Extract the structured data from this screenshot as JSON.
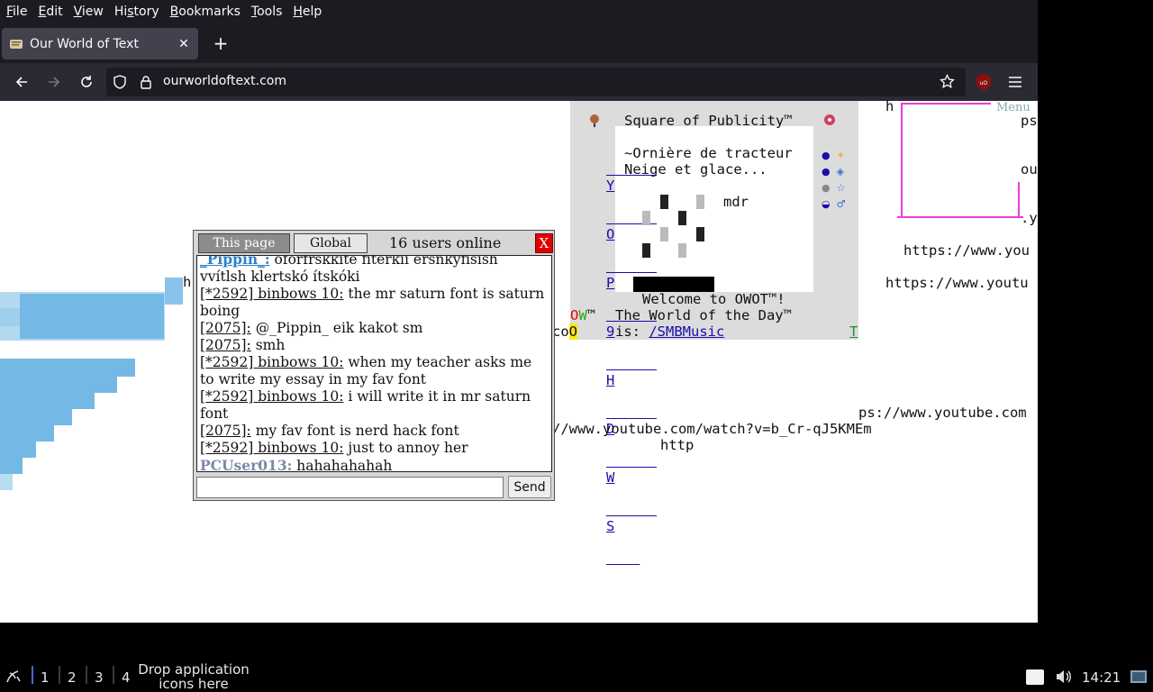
{
  "menubar": {
    "items": [
      "File",
      "Edit",
      "View",
      "History",
      "Bookmarks",
      "Tools",
      "Help"
    ],
    "underline": [
      "F",
      "E",
      "V",
      "s",
      "B",
      "T",
      "H"
    ]
  },
  "tab": {
    "title": "Our World of Text",
    "new_tab_symbol": "+"
  },
  "urlbar": {
    "url": "ourworldoftext.com"
  },
  "page": {
    "sop_title": "Square of Publicity™",
    "sop_line1": "~Ornière de tracteur",
    "sop_line2": "Neige et glace...",
    "sop_mdr": "mdr",
    "sop_welcome": "Welcome to OWOT™!",
    "sop_world_day": "The World of the Day™",
    "sop_is": "is: ",
    "sop_link": "/SMBMusic",
    "sop_left_col": [
      "Y",
      "O",
      "P",
      "9",
      "H",
      "D",
      "W",
      "S"
    ],
    "owot_o": "O",
    "owot_w": "W",
    "owot_tm": "™",
    "co_text": "co",
    "co_o": "O",
    "t_right": "T",
    "h_char": "h",
    "h_char2": "h",
    "menu_label": "Menu",
    "ps_text": "ps",
    "ou_text": "ou",
    "y_text": ".y",
    "yt_url1": "https://www.you",
    "yt_url2": "https://www.youtu",
    "yt_url3": "ps://www.youtube.com",
    "yt_url4": "//www.youtube.com/watch?v=b_Cr-qJ5KMEm",
    "http_text": "http"
  },
  "chat": {
    "tab_this_page": "This page",
    "tab_global": "Global",
    "users_online": "16 users online",
    "close_label": "X",
    "send_label": "Send",
    "input_value": "",
    "messages": [
      {
        "nick": "_Pippin_:",
        "text": " oforfrskkite fiterkii ersnkyfisish vvítlsh klertskó ítskóki",
        "style": "blue"
      },
      {
        "nick": "[*2592] binbows 10:",
        "text": " the mr saturn font is saturn boing",
        "style": "plain"
      },
      {
        "nick": "[2075]:",
        "text": " @_Pippin_ eik kakot sm",
        "style": "plain"
      },
      {
        "nick": "[2075]:",
        "text": " smh",
        "style": "plain"
      },
      {
        "nick": "[*2592] binbows 10:",
        "text": " when my teacher asks me to write my essay in my fav font",
        "style": "plain"
      },
      {
        "nick": "[*2592] binbows 10:",
        "text": " i will write it in mr saturn font",
        "style": "plain"
      },
      {
        "nick": "[2075]:",
        "text": " my fav font is nerd hack font",
        "style": "plain"
      },
      {
        "nick": "[*2592] binbows 10:",
        "text": " just to annoy her",
        "style": "plain"
      },
      {
        "nick": "PCUser013:",
        "text": " hahahahahah",
        "style": "gray"
      }
    ]
  },
  "taskbar": {
    "workspaces": [
      "1",
      "2",
      "3",
      "4"
    ],
    "drop_text_line1": "Drop application",
    "drop_text_line2": "icons here",
    "clock": "14:21"
  },
  "colors": {
    "chrome_dark": "#1c1b22",
    "tab_active": "#42414d",
    "navbar": "#2b2a33",
    "pink": "#ee3cd9",
    "blue_shape": "#74b9e6",
    "close_red": "#e00000"
  }
}
